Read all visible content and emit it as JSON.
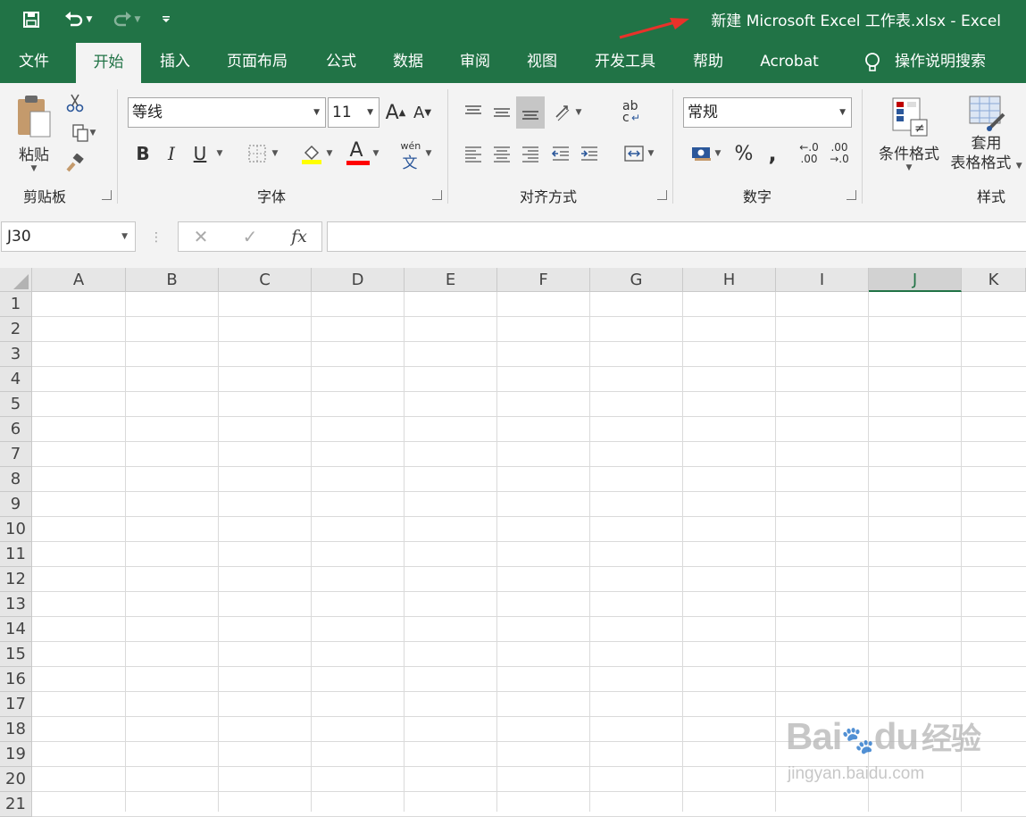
{
  "window": {
    "title": "新建 Microsoft Excel 工作表.xlsx  -  Excel",
    "accent": "#217346",
    "annotation_color": "#e8322a"
  },
  "qat": {
    "icons": [
      "save-icon",
      "undo-icon",
      "redo-icon",
      "customize-qat-icon"
    ]
  },
  "tabs": [
    {
      "label": "文件"
    },
    {
      "label": "开始"
    },
    {
      "label": "插入"
    },
    {
      "label": "页面布局"
    },
    {
      "label": "公式"
    },
    {
      "label": "数据"
    },
    {
      "label": "审阅"
    },
    {
      "label": "视图"
    },
    {
      "label": "开发工具"
    },
    {
      "label": "帮助"
    },
    {
      "label": "Acrobat"
    }
  ],
  "active_tab": "开始",
  "tell_me": "操作说明搜索",
  "ribbon": {
    "clipboard": {
      "label": "剪贴板",
      "paste_label": "粘贴"
    },
    "font": {
      "label": "字体",
      "font_name": "等线",
      "font_size": "11",
      "bold": "B",
      "italic": "I",
      "underline": "U",
      "grow": "A",
      "shrink": "A",
      "font_color": "A",
      "phonetic_top": "wén",
      "phonetic_bottom": "文",
      "fill_color": "#ffff00",
      "text_color": "#ff0000"
    },
    "alignment": {
      "label": "对齐方式",
      "wrap_top": "ab",
      "wrap_bottom": "c"
    },
    "number": {
      "label": "数字",
      "format": "常规",
      "percent": "%",
      "comma": ",",
      "inc_top": "←.0",
      "inc_bottom": ".00",
      "dec_top": ".00",
      "dec_bottom": "→.0"
    },
    "styles": {
      "label": "样式",
      "conditional": "条件格式",
      "table_line1": "套用",
      "table_line2": "表格格式"
    }
  },
  "formula_bar": {
    "name_box": "J30",
    "fx": "fx",
    "cancel": "✕",
    "enter": "✓",
    "content": ""
  },
  "columns": [
    "A",
    "B",
    "C",
    "D",
    "E",
    "F",
    "G",
    "H",
    "I",
    "J",
    "K"
  ],
  "selected_column": "J",
  "rows": [
    "1",
    "2",
    "3",
    "4",
    "5",
    "6",
    "7",
    "8",
    "9",
    "10",
    "11",
    "12",
    "13",
    "14",
    "15",
    "16",
    "17",
    "18",
    "19",
    "20",
    "21"
  ],
  "watermark": {
    "brand": "Bai",
    "brand2": "du",
    "cn": "经验",
    "url": "jingyan.baidu.com"
  }
}
